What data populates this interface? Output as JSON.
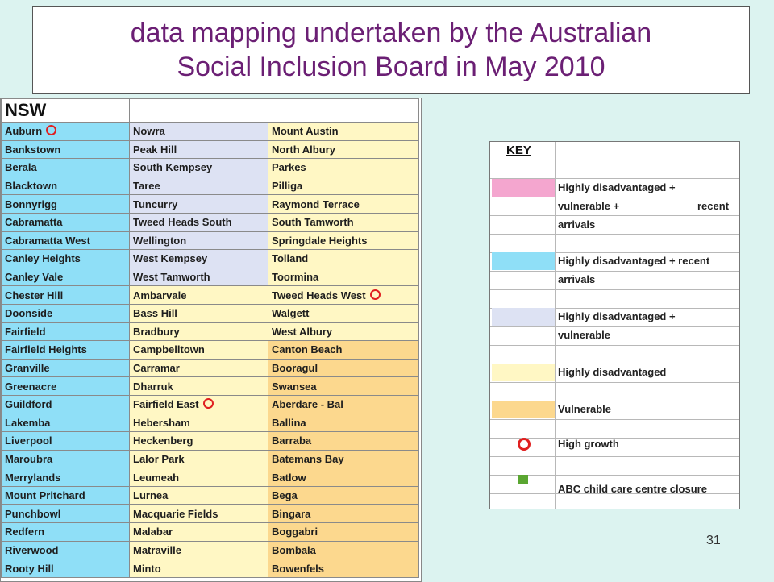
{
  "title": {
    "line1": "data mapping undertaken by the Australian",
    "line2": "Social Inclusion Board in May 2010"
  },
  "nsw_table": {
    "heading": "NSW",
    "rows": [
      {
        "c1": "Auburn",
        "c1_icon": "high-growth-ring",
        "c1_color": "blue",
        "c2": "Nowra",
        "c2_color": "lavender",
        "c3": "Mount Austin",
        "c3_color": "yellow"
      },
      {
        "c1": "Bankstown",
        "c1_color": "blue",
        "c2": "Peak Hill",
        "c2_color": "lavender",
        "c3": "North Albury",
        "c3_color": "yellow"
      },
      {
        "c1": "Berala",
        "c1_color": "blue",
        "c2": "South Kempsey",
        "c2_color": "lavender",
        "c3": "Parkes",
        "c3_color": "yellow"
      },
      {
        "c1": "Blacktown",
        "c1_color": "blue",
        "c2": "Taree",
        "c2_color": "lavender",
        "c3": "Pilliga",
        "c3_color": "yellow"
      },
      {
        "c1": "Bonnyrigg",
        "c1_color": "blue",
        "c2": "Tuncurry",
        "c2_color": "lavender",
        "c3": "Raymond Terrace",
        "c3_color": "yellow"
      },
      {
        "c1": "Cabramatta",
        "c1_color": "blue",
        "c2": "Tweed Heads South",
        "c2_color": "lavender",
        "c3": "South Tamworth",
        "c3_color": "yellow"
      },
      {
        "c1": "Cabramatta West",
        "c1_color": "blue",
        "c2": "Wellington",
        "c2_color": "lavender",
        "c3": "Springdale Heights",
        "c3_color": "yellow"
      },
      {
        "c1": "Canley Heights",
        "c1_color": "blue",
        "c2": "West Kempsey",
        "c2_color": "lavender",
        "c3": "Tolland",
        "c3_color": "yellow"
      },
      {
        "c1": "Canley Vale",
        "c1_color": "blue",
        "c2": "West Tamworth",
        "c2_color": "lavender",
        "c3": "Toormina",
        "c3_color": "yellow"
      },
      {
        "c1": "Chester Hill",
        "c1_color": "blue",
        "c2": "Ambarvale",
        "c2_color": "yellow",
        "c3": "Tweed Heads West",
        "c3_icon": "high-growth-ring",
        "c3_color": "yellow"
      },
      {
        "c1": "Doonside",
        "c1_color": "blue",
        "c2": "Bass Hill",
        "c2_color": "yellow",
        "c3": "Walgett",
        "c3_color": "yellow"
      },
      {
        "c1": "Fairfield",
        "c1_color": "blue",
        "c2": "Bradbury",
        "c2_color": "yellow",
        "c3": "West Albury",
        "c3_color": "yellow"
      },
      {
        "c1": "Fairfield Heights",
        "c1_color": "blue",
        "c2": "Campbelltown",
        "c2_color": "yellow",
        "c3": "Canton Beach",
        "c3_color": "orange"
      },
      {
        "c1": "Granville",
        "c1_color": "blue",
        "c2": "Carramar",
        "c2_color": "yellow",
        "c3": "Booragul",
        "c3_color": "orange"
      },
      {
        "c1": "Greenacre",
        "c1_color": "blue",
        "c2": "Dharruk",
        "c2_color": "yellow",
        "c3": "Swansea",
        "c3_color": "orange"
      },
      {
        "c1": "Guildford",
        "c1_color": "blue",
        "c2": "Fairfield East",
        "c2_icon": "high-growth-ring",
        "c2_color": "yellow",
        "c3": "Aberdare - Bal",
        "c3_color": "orange"
      },
      {
        "c1": "Lakemba",
        "c1_color": "blue",
        "c2": "Hebersham",
        "c2_color": "yellow",
        "c3": "Ballina",
        "c3_color": "orange"
      },
      {
        "c1": "Liverpool",
        "c1_color": "blue",
        "c2": "Heckenberg",
        "c2_color": "yellow",
        "c3": "Barraba",
        "c3_color": "orange"
      },
      {
        "c1": "Maroubra",
        "c1_color": "blue",
        "c2": "Lalor Park",
        "c2_color": "yellow",
        "c3": "Batemans Bay",
        "c3_color": "orange"
      },
      {
        "c1": "Merrylands",
        "c1_color": "blue",
        "c2": "Leumeah",
        "c2_color": "yellow",
        "c3": "Batlow",
        "c3_color": "orange"
      },
      {
        "c1": "Mount Pritchard",
        "c1_color": "blue",
        "c2": "Lurnea",
        "c2_color": "yellow",
        "c3": "Bega",
        "c3_color": "orange"
      },
      {
        "c1": "Punchbowl",
        "c1_color": "blue",
        "c2": "Macquarie Fields",
        "c2_color": "yellow",
        "c3": "Bingara",
        "c3_color": "orange"
      },
      {
        "c1": "Redfern",
        "c1_color": "blue",
        "c2": "Malabar",
        "c2_color": "yellow",
        "c3": "Boggabri",
        "c3_color": "orange"
      },
      {
        "c1": "Riverwood",
        "c1_color": "blue",
        "c2": "Matraville",
        "c2_color": "yellow",
        "c3": "Bombala",
        "c3_color": "orange"
      },
      {
        "c1": "Rooty Hill",
        "c1_color": "blue",
        "c2": "Minto",
        "c2_color": "yellow",
        "c3": "Bowenfels",
        "c3_color": "orange"
      }
    ]
  },
  "colors": {
    "pink": "#f4a6cf",
    "blue": "#8fdff7",
    "lavender": "#dde2f3",
    "yellow": "#fff7c4",
    "orange": "#fcd88e",
    "high_growth": "#e02020",
    "closure": "#5aa631"
  },
  "key": {
    "title": "KEY",
    "items": {
      "pink_line1": "Highly disadvantaged +",
      "pink_line2a": "vulnerable +",
      "pink_line2b": "recent",
      "pink_line3": "arrivals",
      "blue_line1": "Highly disadvantaged + recent",
      "blue_line2": "arrivals",
      "lavender_line1": "Highly disadvantaged +",
      "lavender_line2": "vulnerable",
      "yellow": "Highly disadvantaged",
      "orange": "Vulnerable",
      "ring": "High growth",
      "square": "ABC child care centre closure"
    }
  },
  "page_number": "31"
}
